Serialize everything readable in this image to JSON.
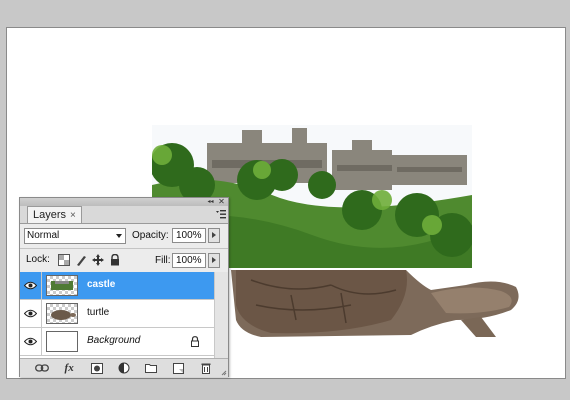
{
  "panel": {
    "tab_label": "Layers",
    "tab_close": "×",
    "collapse_glyph": "◂◂",
    "close_glyph": "✕",
    "blend_mode": "Normal",
    "opacity_label": "Opacity:",
    "opacity_value": "100%",
    "lock_label": "Lock:",
    "fill_label": "Fill:",
    "fill_value": "100%",
    "fx_label": "fx"
  },
  "layers": [
    {
      "name": "castle",
      "selected": true,
      "thumbnail": "castle-thumbnail"
    },
    {
      "name": "turtle",
      "selected": false,
      "thumbnail": "turtle-thumbnail"
    },
    {
      "name": "Background",
      "selected": false,
      "thumbnail": "background-thumbnail",
      "locked": true
    }
  ],
  "colors": {
    "selection": "#3d99f0",
    "workspace": "#c8c8c8",
    "canvas": "#ffffff"
  },
  "icons": [
    "eye-icon",
    "lock-icon",
    "link-icon",
    "fx-icon",
    "mask-icon",
    "adjustment-icon",
    "folder-icon",
    "new-layer-icon",
    "trash-icon",
    "panel-menu-icon"
  ]
}
